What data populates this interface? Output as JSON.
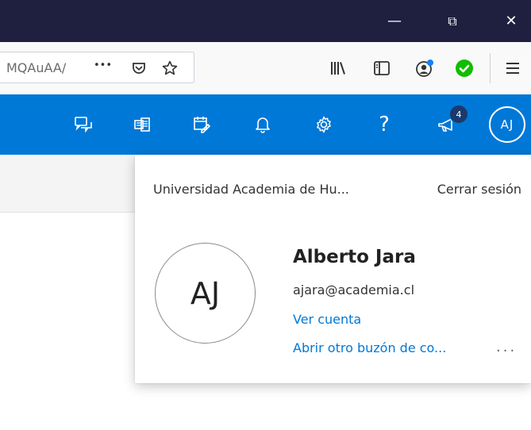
{
  "window": {
    "minimize_glyph": "—",
    "restore_glyph": "⧉",
    "close_glyph": "✕"
  },
  "browser": {
    "url_partial": "MQAuAA/",
    "more_glyph": "•••",
    "icons": [
      "pocket-icon",
      "bookmark-star-icon",
      "library-icon",
      "sidebar-icon",
      "account-icon",
      "shield-check-icon",
      "hamburger-menu-icon"
    ],
    "check_color": "#12bc00"
  },
  "header": {
    "accent": "#0078d7",
    "icons": [
      "feedback-icon",
      "office-apps-icon",
      "my-day-icon",
      "bell-icon",
      "gear-icon",
      "help-icon",
      "megaphone-icon"
    ],
    "help_glyph": "?",
    "notification_count": "4",
    "avatar_initials": "AJ"
  },
  "account_panel": {
    "organization": "Universidad Academia de Hu...",
    "sign_out": "Cerrar sesión",
    "avatar_initials": "AJ",
    "name": "Alberto Jara",
    "email": "ajara@academia.cl",
    "view_account": "Ver cuenta",
    "open_other_mailbox": "Abrir otro buzón de co...",
    "more_glyph": "..."
  }
}
